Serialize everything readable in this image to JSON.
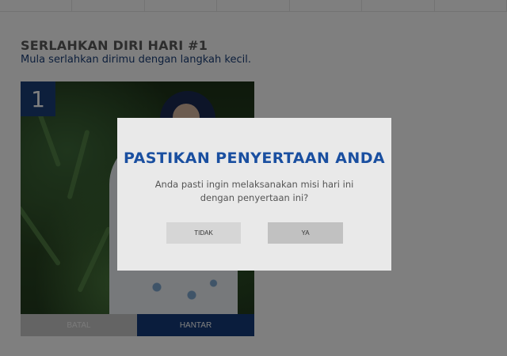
{
  "page": {
    "heading": "SERLAHKAN DIRI HARI #1",
    "subheading": "Mula serlahkan dirimu dengan langkah kecil."
  },
  "card": {
    "number": "1",
    "cancel_label": "BATAL",
    "submit_label": "HANTAR"
  },
  "modal": {
    "title": "PASTIKAN PENYERTAAN ANDA",
    "message_line1": "Anda pasti ingin melaksanakan misi hari ini",
    "message_line2": "dengan penyertaan ini?",
    "no_label": "TIDAK",
    "yes_label": "YA"
  },
  "colors": {
    "brand_navy": "#143a7a",
    "modal_title_blue": "#1a4fa0",
    "overlay": "rgba(0,0,0,0.5)"
  }
}
